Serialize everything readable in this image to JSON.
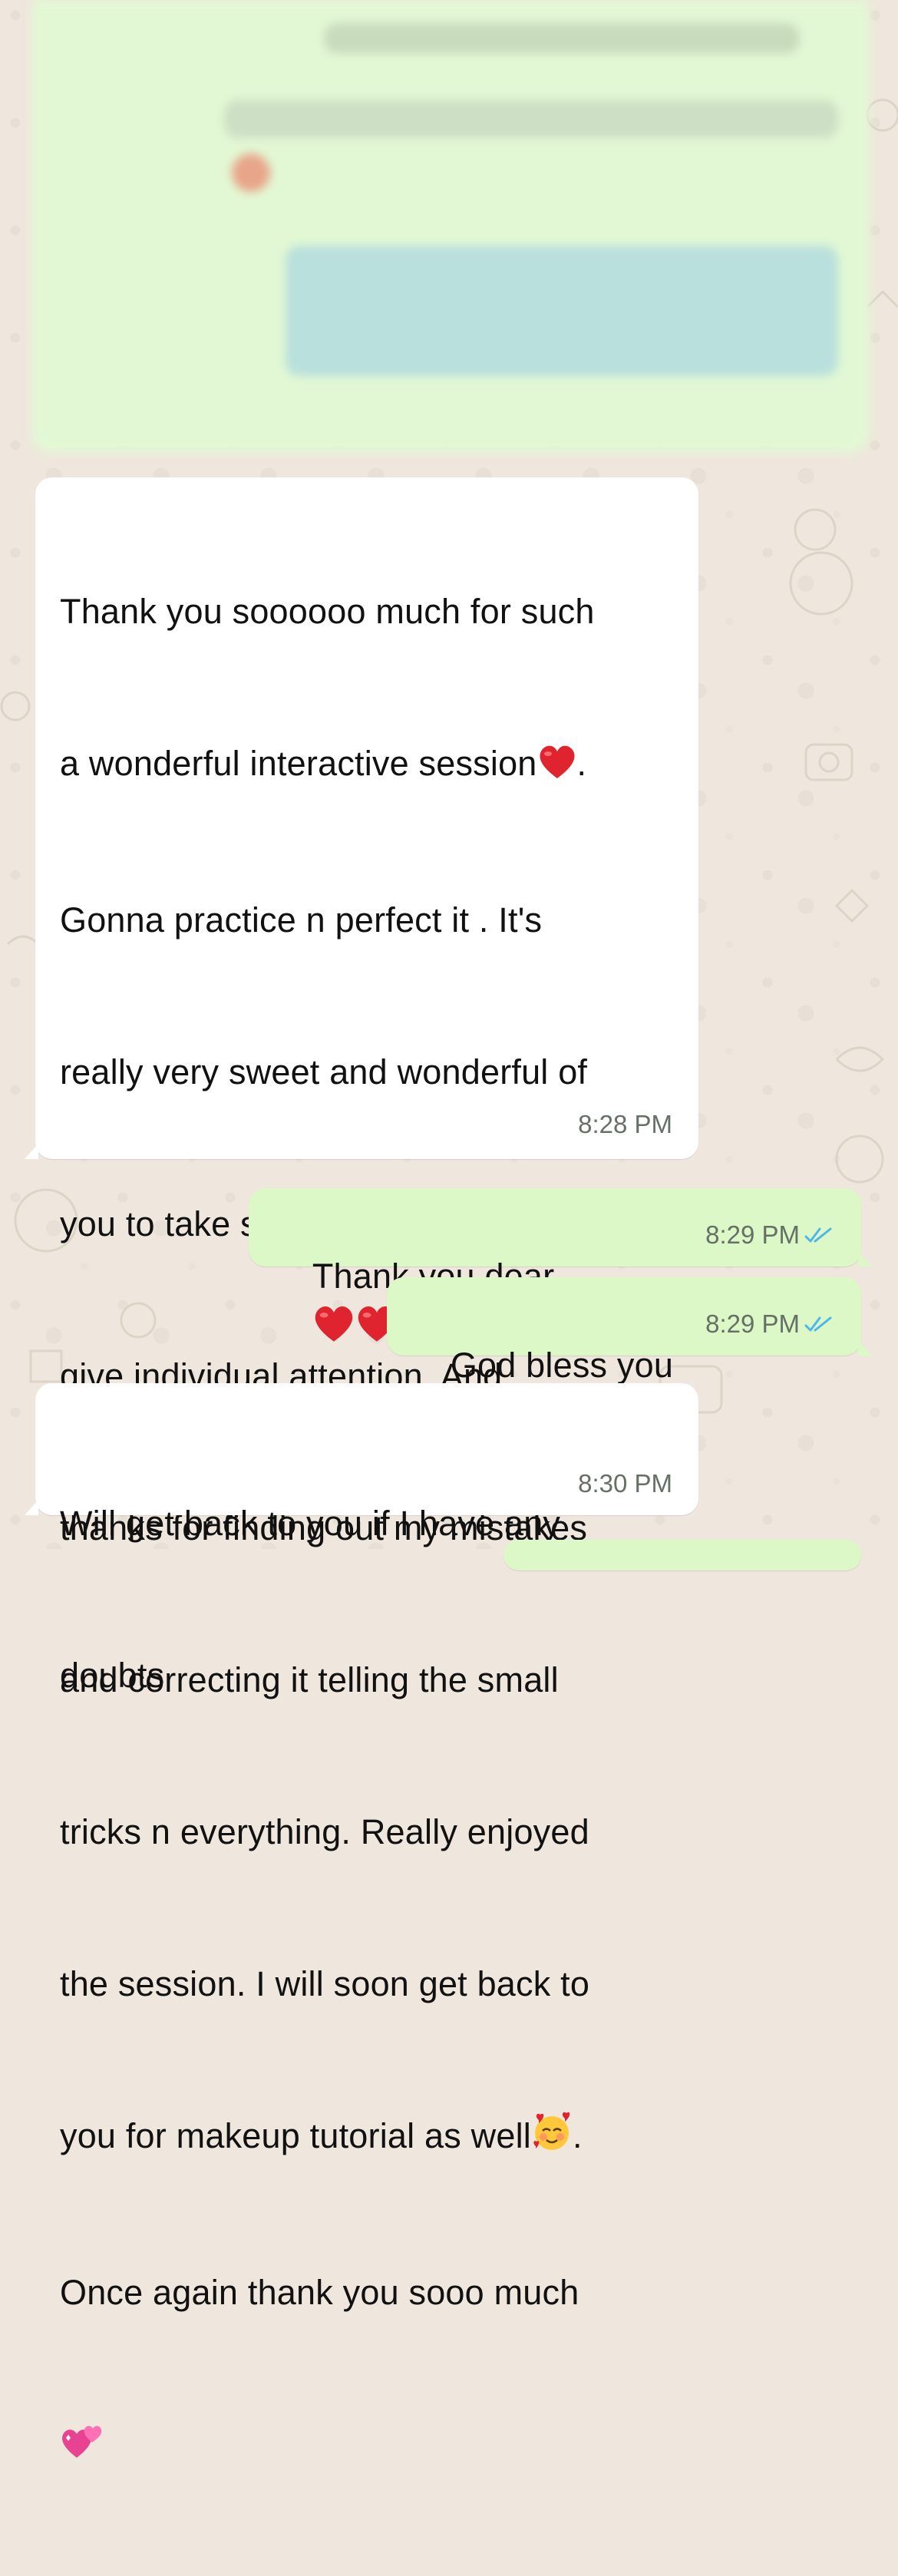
{
  "messages": [
    {
      "direction": "incoming",
      "lines": [
        "Thank you soooooo much for such",
        "a wonderful interactive session",
        "Gonna practice n perfect it . It's",
        "really very sweet and wonderful of",
        "you to take separate sessions and",
        "give individual attention. And",
        "thanks for finding out my mistakes",
        "and correcting it telling the small",
        "tricks n everything. Really enjoyed",
        "the session. I will soon get back to",
        "you for makeup tutorial as well",
        "Once again thank you sooo much"
      ],
      "line2_suffix": ".",
      "line11_suffix": ".",
      "time": "8:28 PM"
    },
    {
      "direction": "outgoing",
      "text": "Thank you dear",
      "time": "8:29 PM",
      "status": "read"
    },
    {
      "direction": "outgoing",
      "text": "God bless you",
      "time": "8:29 PM",
      "status": "read"
    },
    {
      "direction": "incoming",
      "lines": [
        "Will get back to you if I have any",
        "doubts"
      ],
      "time": "8:30 PM"
    }
  ],
  "colors": {
    "background": "#efe7dd",
    "incoming_bubble": "#ffffff",
    "outgoing_bubble": "#dcf8c6",
    "read_ticks": "#4fb6ec",
    "heart": "#e0242f"
  }
}
